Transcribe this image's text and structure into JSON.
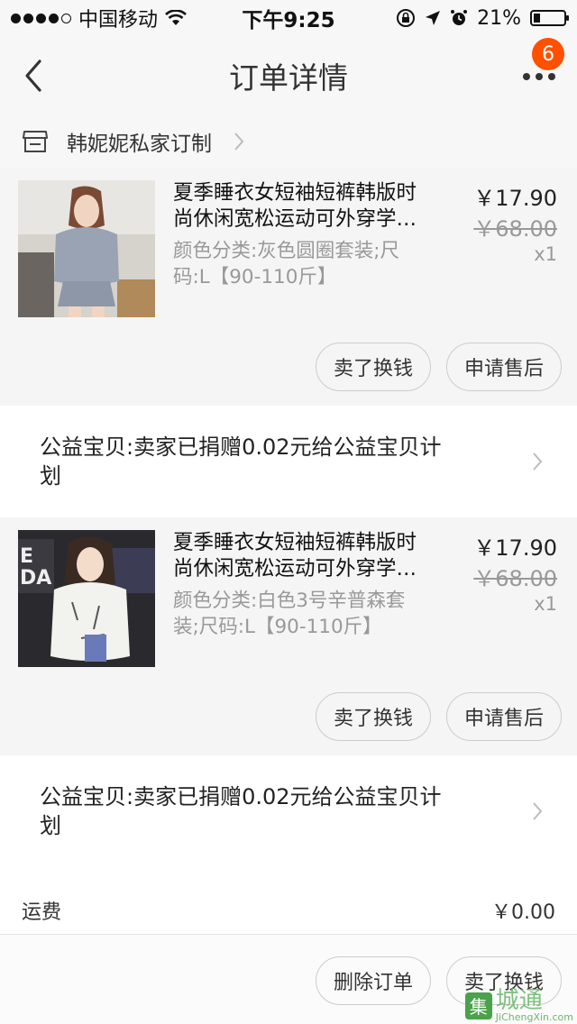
{
  "status_bar": {
    "carrier": "中国移动",
    "time": "下午9:25",
    "battery": "21%"
  },
  "nav": {
    "title": "订单详情",
    "badge": "6"
  },
  "shop": {
    "name": "韩妮妮私家订制"
  },
  "items": [
    {
      "title_line1": "夏季睡衣女短袖短裤韩版时",
      "title_line2": "尚休闲宽松运动可外穿学…",
      "sku_line1": "颜色分类:灰色圆圈套装;尺",
      "sku_line2": "码:L【90-110斤】",
      "price": "￥17.90",
      "original_price": "￥68.00",
      "quantity": "x1",
      "sell_label": "卖了换钱",
      "aftersale_label": "申请售后"
    },
    {
      "title_line1": "夏季睡衣女短袖短裤韩版时",
      "title_line2": "尚休闲宽松运动可外穿学…",
      "sku_line1": "颜色分类:白色3号辛普森套",
      "sku_line2": "装;尺码:L【90-110斤】",
      "price": "￥17.90",
      "original_price": "￥68.00",
      "quantity": "x1",
      "sell_label": "卖了换钱",
      "aftersale_label": "申请售后"
    }
  ],
  "charity": [
    {
      "line1": "公益宝贝:卖家已捐赠0.02元给公益宝贝计",
      "line2": "划"
    },
    {
      "line1": "公益宝贝:卖家已捐赠0.02元给公益宝贝计",
      "line2": "划"
    }
  ],
  "summary": {
    "shipping_label": "运费",
    "shipping_value": "￥0.00"
  },
  "bottom": {
    "delete_label": "删除订单",
    "sell_label": "卖了换钱"
  },
  "watermark": {
    "cn": "城通",
    "en": "JiChengXin.com",
    "box": "集"
  },
  "colors": {
    "accent": "#ff5000",
    "text": "#222222",
    "muted": "#999999"
  }
}
